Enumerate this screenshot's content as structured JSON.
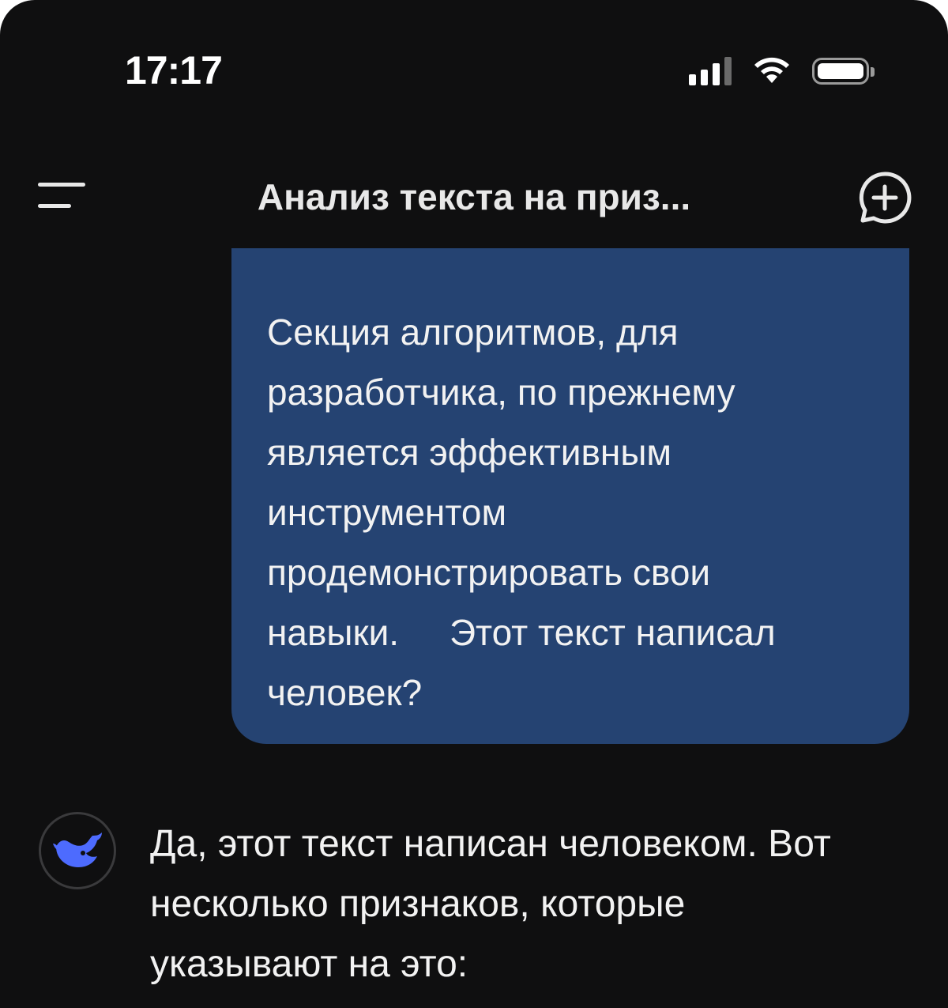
{
  "status_bar": {
    "time": "17:17",
    "signal_icon": "cellular-signal-icon",
    "wifi_icon": "wifi-icon",
    "battery_icon": "battery-icon"
  },
  "header": {
    "menu_icon": "menu-icon",
    "title": "Анализ текста на приз...",
    "new_chat_icon": "new-chat-plus-icon"
  },
  "messages": [
    {
      "role": "user",
      "text": "Секция алгоритмов, для\nразработчика, по прежнему\nявляется эффективным\nинструментом\nпродемонстрировать свои\nнавыки.     Этот текст написал\nчеловек?"
    },
    {
      "role": "assistant",
      "avatar_icon": "whale-logo-icon",
      "text": "Да, этот текст написан человеком. Вот\nнесколько признаков, которые\nуказывают на это:"
    }
  ],
  "colors": {
    "background": "#0f0f10",
    "user_bubble": "#254372",
    "brand_accent": "#4d6bfe",
    "text": "#f2f2f2"
  }
}
